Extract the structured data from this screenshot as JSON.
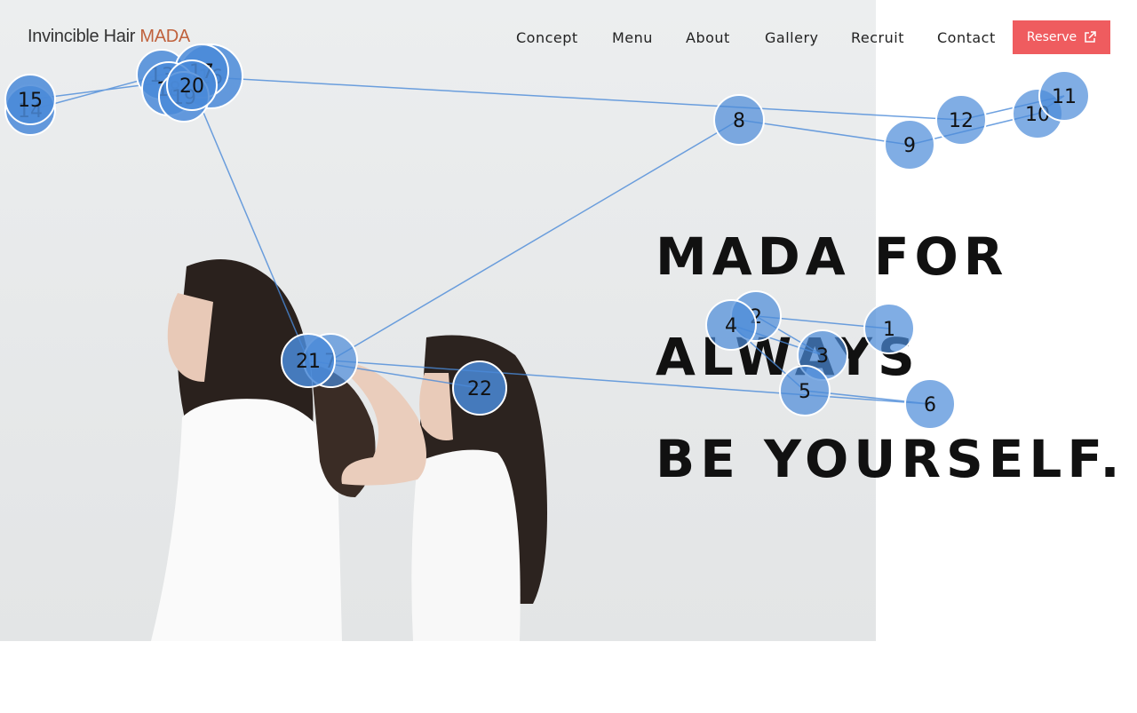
{
  "logo": {
    "text_main": "Invincible Hair ",
    "text_accent": "MADA"
  },
  "nav": [
    {
      "label": "Concept"
    },
    {
      "label": "Menu"
    },
    {
      "label": "About"
    },
    {
      "label": "Gallery"
    },
    {
      "label": "Recruit"
    },
    {
      "label": "Contact"
    }
  ],
  "reserve": {
    "label": "Reserve",
    "icon": "external-link-icon"
  },
  "headline": {
    "line1": "MADA FOR",
    "line2": "ALWAYS",
    "line3": "BE YOURSELF."
  },
  "colors": {
    "accent": "#ef5c5f",
    "logo_accent": "#c0623d",
    "fixation": "#4a8ad8"
  },
  "fixations": [
    "1",
    "2",
    "3",
    "4",
    "5",
    "6",
    "7",
    "8",
    "9",
    "10",
    "11",
    "12",
    "13",
    "14",
    "15",
    "16",
    "17",
    "18",
    "19",
    "20",
    "21",
    "22"
  ]
}
